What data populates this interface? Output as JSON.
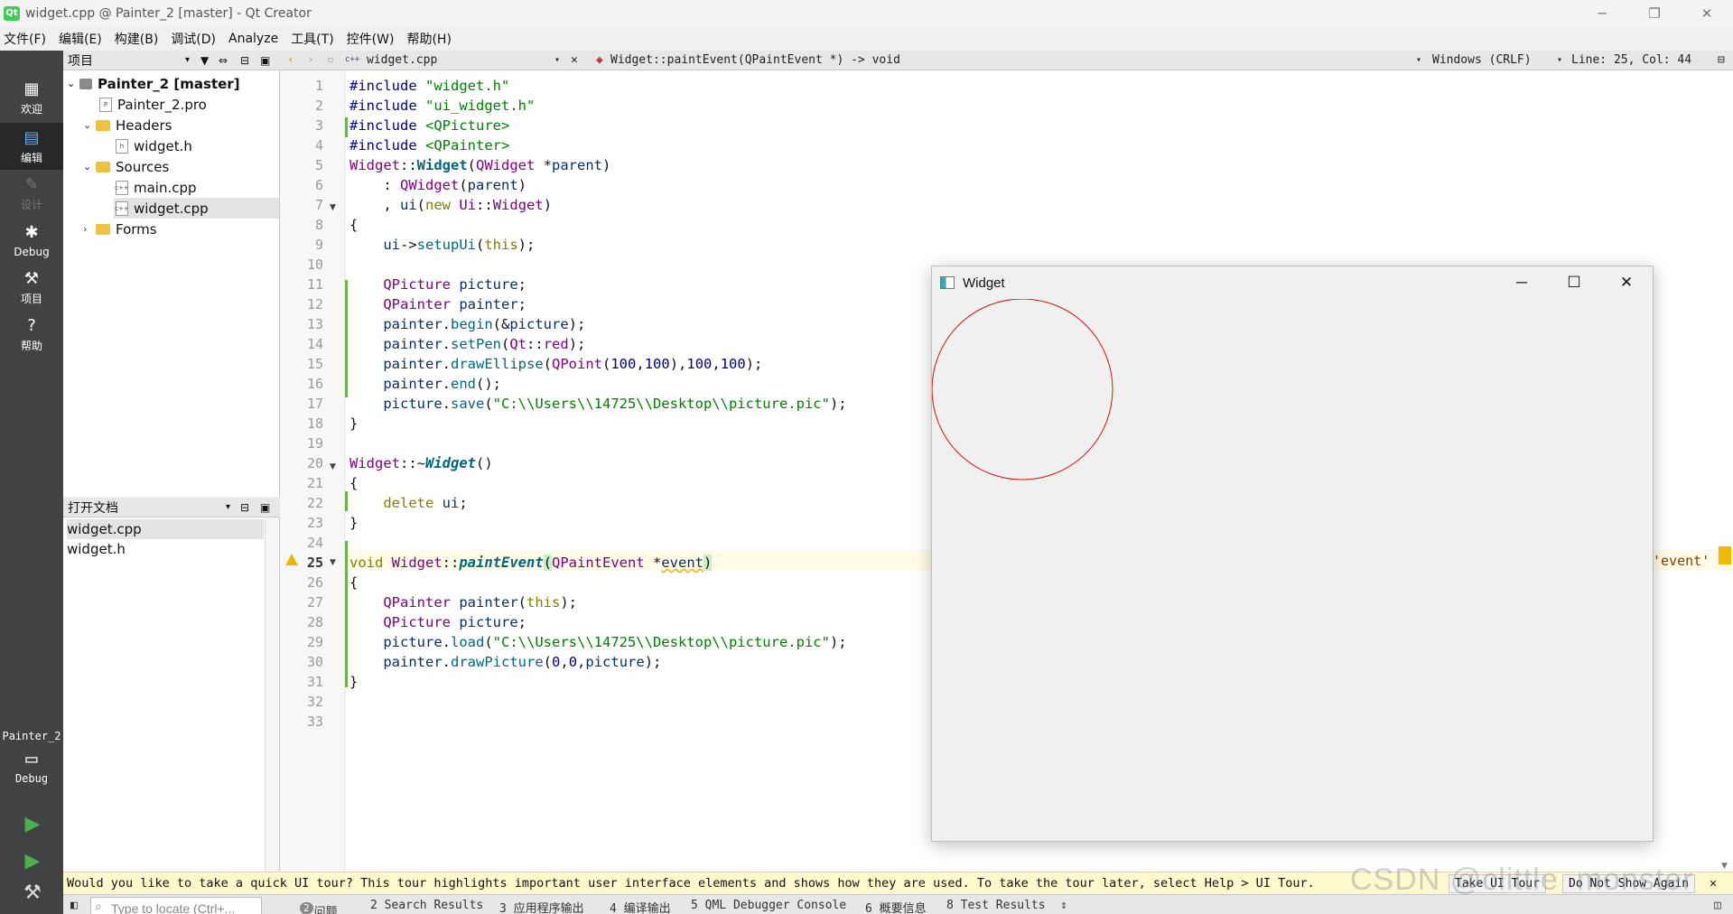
{
  "window": {
    "title": "widget.cpp @ Painter_2 [master] - Qt Creator",
    "minimize": "─",
    "restore": "❐",
    "close": "✕"
  },
  "menu": [
    "文件(F)",
    "编辑(E)",
    "构建(B)",
    "调试(D)",
    "Analyze",
    "工具(T)",
    "控件(W)",
    "帮助(H)"
  ],
  "modes": [
    {
      "label": "欢迎",
      "icon": "grid-icon"
    },
    {
      "label": "编辑",
      "icon": "edit-icon"
    },
    {
      "label": "设计",
      "icon": "pencil-icon"
    },
    {
      "label": "Debug",
      "icon": "bug-icon"
    },
    {
      "label": "项目",
      "icon": "wrench-icon"
    },
    {
      "label": "帮助",
      "icon": "help-icon"
    }
  ],
  "kit": {
    "project": "Painter_2",
    "config": "Debug"
  },
  "project_panel": {
    "header": "项目",
    "tree": [
      {
        "label": "Painter_2 [master]",
        "kind": "project"
      },
      {
        "label": "Painter_2.pro",
        "kind": "pro"
      },
      {
        "label": "Headers",
        "kind": "folder"
      },
      {
        "label": "widget.h",
        "kind": "header"
      },
      {
        "label": "Sources",
        "kind": "folder"
      },
      {
        "label": "main.cpp",
        "kind": "cpp"
      },
      {
        "label": "widget.cpp",
        "kind": "cpp"
      },
      {
        "label": "Forms",
        "kind": "folder"
      }
    ]
  },
  "open_docs": {
    "header": "打开文档",
    "items": [
      "widget.cpp",
      "widget.h"
    ]
  },
  "editor_toolbar": {
    "file": "widget.cpp",
    "symbol": "Widget::paintEvent(QPaintEvent *) -> void",
    "line_endings": "Windows (CRLF)",
    "position": "Line: 25, Col: 44"
  },
  "editor": {
    "current_line": 25,
    "lines": [
      "1",
      "2",
      "3",
      "4",
      "5",
      "6",
      "7",
      "8",
      "9",
      "10",
      "11",
      "12",
      "13",
      "14",
      "15",
      "16",
      "17",
      "18",
      "19",
      "20",
      "21",
      "22",
      "23",
      "24",
      "25",
      "26",
      "27",
      "28",
      "29",
      "30",
      "31",
      "32",
      "33"
    ],
    "warning_text": "'event'"
  },
  "widget_window": {
    "title": "Widget",
    "circle_color": "#e01010"
  },
  "tour": {
    "message": "Would you like to take a quick UI tour? This tour highlights important user interface elements and shows how they are used. To take the tour later, select Help > UI Tour.",
    "take_button": "Take UI Tour",
    "dismiss_button": "Do Not Show Again",
    "watermark": "CSDN @clittle_monster"
  },
  "statusbar": {
    "locator_placeholder": "Type to locate (Ctrl+...",
    "tabs": [
      "1 问题",
      "2 Search Results",
      "3 应用程序输出",
      "4 编译输出",
      "5 QML Debugger Console",
      "6 概要信息",
      "8 Test Results"
    ],
    "issues_count": "2"
  }
}
